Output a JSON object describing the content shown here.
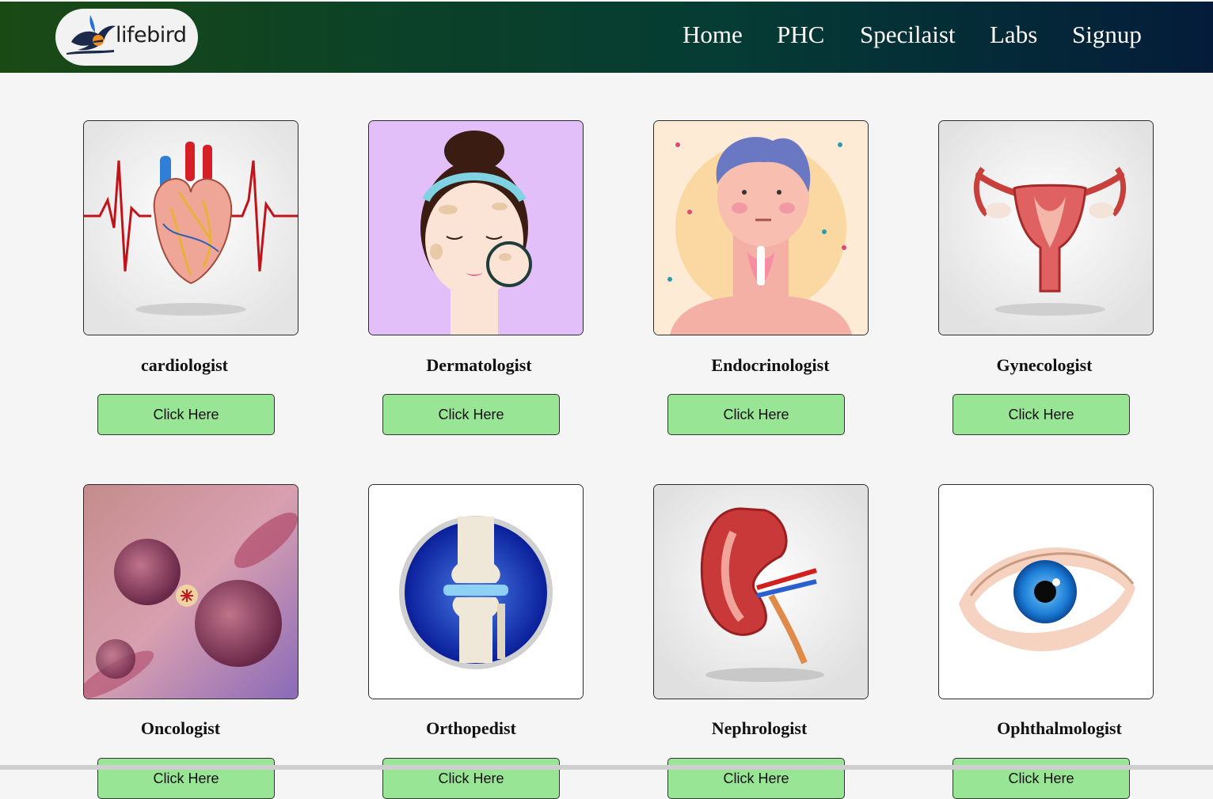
{
  "brand": {
    "name": "lifebird",
    "logo_icon": "bird-logo-icon"
  },
  "nav": {
    "items": [
      {
        "label": "Home"
      },
      {
        "label": "PHC"
      },
      {
        "label": "Specilaist"
      },
      {
        "label": "Labs"
      },
      {
        "label": "Signup"
      }
    ]
  },
  "colors": {
    "button_bg": "#98e695",
    "nav_gradient_start": "#1a4a14",
    "nav_gradient_end": "#041c3a",
    "page_bg": "#f5f5f5"
  },
  "cards": [
    {
      "title": "cardiologist",
      "button": "Click Here",
      "image": "heart-image"
    },
    {
      "title": "Dermatologist",
      "button": "Click Here",
      "image": "skin-face-image"
    },
    {
      "title": "Endocrinologist",
      "button": "Click Here",
      "image": "thyroid-image"
    },
    {
      "title": "Gynecologist",
      "button": "Click Here",
      "image": "uterus-image"
    },
    {
      "title": "Oncologist",
      "button": "Click Here",
      "image": "cancer-cells-image"
    },
    {
      "title": "Orthopedist",
      "button": "Click Here",
      "image": "knee-joint-image"
    },
    {
      "title": "Nephrologist",
      "button": "Click Here",
      "image": "kidney-image"
    },
    {
      "title": "Ophthalmologist",
      "button": "Click Here",
      "image": "eye-image"
    }
  ]
}
